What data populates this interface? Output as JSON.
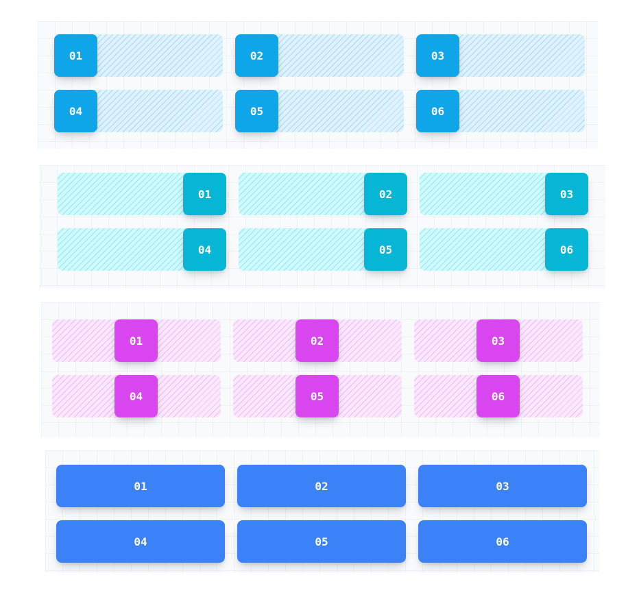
{
  "colors": {
    "panel_bg": "#f8fafc",
    "sky": "#0ea5e9",
    "sky_track": "#e0f2fe",
    "cyan": "#06b6d4",
    "cyan_track": "#cffafe",
    "fuchsia": "#d946ef",
    "fuchsia_track": "#fae8ff",
    "blue": "#3b82f6"
  },
  "section_start": {
    "items": [
      "01",
      "02",
      "03",
      "04",
      "05",
      "06"
    ]
  },
  "section_end": {
    "items": [
      "01",
      "02",
      "03",
      "04",
      "05",
      "06"
    ]
  },
  "section_center": {
    "items": [
      "01",
      "02",
      "03",
      "04",
      "05",
      "06"
    ]
  },
  "section_stretch": {
    "items": [
      "01",
      "02",
      "03",
      "04",
      "05",
      "06"
    ]
  }
}
